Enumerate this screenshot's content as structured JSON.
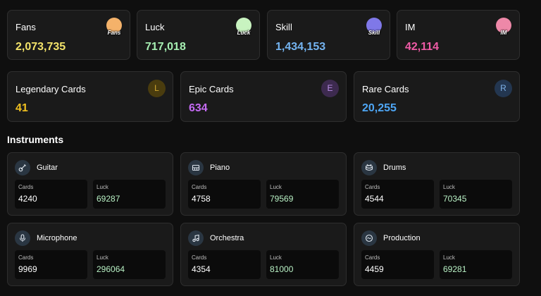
{
  "stats": [
    {
      "label": "Fans",
      "value": "2,073,735",
      "color": "#f3e36a",
      "badge_text": "Fans",
      "badge_color": "#f4b26a",
      "icon": "fans-badge-icon"
    },
    {
      "label": "Luck",
      "value": "717,018",
      "color": "#a6efb2",
      "badge_text": "Luck",
      "badge_color": "#c8f3c0",
      "icon": "luck-badge-icon"
    },
    {
      "label": "Skill",
      "value": "1,434,153",
      "color": "#74b4f1",
      "badge_text": "Skill",
      "badge_color": "#7f78e8",
      "icon": "skill-badge-icon"
    },
    {
      "label": "IM",
      "value": "42,114",
      "color": "#ef5ba6",
      "badge_text": "IM",
      "badge_color": "#ee88a8",
      "icon": "im-badge-icon"
    }
  ],
  "rarity": [
    {
      "label": "Legendary Cards",
      "value": "41",
      "letter": "L",
      "color": "#f0c020",
      "badge_bg": "#4a3c0e",
      "badge_fg": "#d1a830"
    },
    {
      "label": "Epic Cards",
      "value": "634",
      "letter": "E",
      "color": "#c46af2",
      "badge_bg": "#3d2a4f",
      "badge_fg": "#b98ee6"
    },
    {
      "label": "Rare Cards",
      "value": "20,255",
      "letter": "R",
      "color": "#4ea6f5",
      "badge_bg": "#233650",
      "badge_fg": "#7fb3ea"
    }
  ],
  "instruments_title": "Instruments",
  "instruments": [
    {
      "name": "Guitar",
      "icon": "guitar-icon",
      "cards_label": "Cards",
      "cards": "4240",
      "luck_label": "Luck",
      "luck": "69287"
    },
    {
      "name": "Piano",
      "icon": "piano-icon",
      "cards_label": "Cards",
      "cards": "4758",
      "luck_label": "Luck",
      "luck": "79569"
    },
    {
      "name": "Drums",
      "icon": "drums-icon",
      "cards_label": "Cards",
      "cards": "4544",
      "luck_label": "Luck",
      "luck": "70345"
    },
    {
      "name": "Microphone",
      "icon": "microphone-icon",
      "cards_label": "Cards",
      "cards": "9969",
      "luck_label": "Luck",
      "luck": "296064"
    },
    {
      "name": "Orchestra",
      "icon": "music-note-icon",
      "cards_label": "Cards",
      "cards": "4354",
      "luck_label": "Luck",
      "luck": "81000"
    },
    {
      "name": "Production",
      "icon": "production-icon",
      "cards_label": "Cards",
      "cards": "4459",
      "luck_label": "Luck",
      "luck": "69281"
    }
  ]
}
